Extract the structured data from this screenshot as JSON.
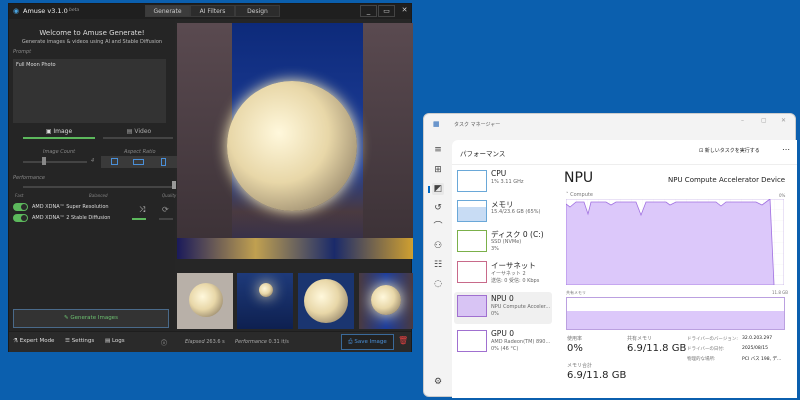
{
  "amuse": {
    "title": "Amuse v3.1.0",
    "beta": "beta",
    "tabs": [
      "Generate",
      "AI Filters",
      "Design"
    ],
    "welcome": "Welcome to Amuse Generate!",
    "subtitle": "Generate images & videos using AI and Stable Diffusion",
    "prompt_label": "Prompt",
    "prompt_value": "Full Moon Photo",
    "mode_image": "Image",
    "mode_video": "Video",
    "image_count_label": "Image Count",
    "image_count": "4",
    "aspect_label": "Aspect Ratio",
    "performance_label": "Performance",
    "perf_fast": "Fast",
    "perf_balanced": "Balanced",
    "perf_quality": "Quality",
    "toggle1": "AMD XDNA™ Super Resolution",
    "toggle2": "AMD XDNA™ 2 Stable Diffusion",
    "generate": "Generate Images",
    "expert": "Expert Mode",
    "settings": "Settings",
    "logs": "Logs",
    "elapsed_label": "Elapsed",
    "elapsed": "263.6 s",
    "perf_stat_label": "Performance",
    "perf_stat": "0.31 it/s",
    "save": "Save Image"
  },
  "tm": {
    "title": "タスク マネージャー",
    "section": "パフォーマンス",
    "run_task": "新しいタスクを実行する",
    "items": [
      {
        "name": "CPU",
        "sub": "1%  3.11 GHz",
        "sub2": ""
      },
      {
        "name": "メモリ",
        "sub": "15.4/23.6 GB (65%)",
        "sub2": ""
      },
      {
        "name": "ディスク 0 (C:)",
        "sub": "SSD (NVMe)",
        "sub2": "3%"
      },
      {
        "name": "イーサネット",
        "sub": "イーサネット 2",
        "sub2": "送信: 0  受信: 0 Kbps"
      },
      {
        "name": "NPU 0",
        "sub": "NPU Compute Acceler...",
        "sub2": "0%"
      },
      {
        "name": "GPU 0",
        "sub": "AMD Radeon(TM) 890...",
        "sub2": "0%  (46 °C)"
      }
    ],
    "heading": "NPU",
    "device": "NPU Compute Accelerator Device",
    "compute_label": "Compute",
    "compute_max": "0%",
    "shared_label": "共有メモリ",
    "shared_max": "11.8 GB",
    "usage_label": "使用率",
    "usage": "0%",
    "shared_mem_label": "共有メモリ",
    "shared_mem": "6.9/11.8 GB",
    "mem_total_label": "メモリ合計",
    "mem_total": "6.9/11.8 GB",
    "driver_version_label": "ドライバーのバージョン:",
    "driver_version": "32.0.203.297",
    "driver_date_label": "ドライバーの日付:",
    "driver_date": "2025/08/15",
    "location_label": "物理的な場所:",
    "location": "PCI バス 198, デ..."
  }
}
